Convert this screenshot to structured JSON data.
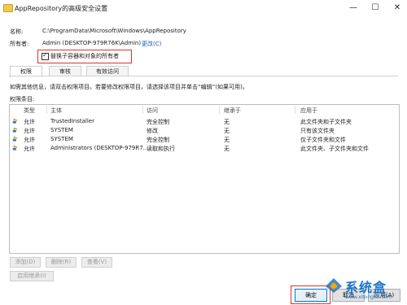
{
  "window": {
    "title": "AppRepository的高级安全设置",
    "minimize": "—",
    "maximize": "☐",
    "close": "✕"
  },
  "info": {
    "name_label": "名称:",
    "name_value": "C:\\ProgramData\\Microsoft\\Windows\\AppRepository",
    "owner_label": "所有者:",
    "owner_value": "Admin (DESKTOP-979R76K\\Admin)",
    "change_link": "更改(C)",
    "replace_owner_checkbox": "替换子容器和对象的所有者",
    "replace_owner_checked": true
  },
  "tabs": [
    {
      "label": "权限",
      "active": true
    },
    {
      "label": "审核",
      "active": false
    },
    {
      "label": "有效访问",
      "active": false
    }
  ],
  "panel": {
    "hint": "如需其他信息，请双击权限项目。若要修改权限项目，请选择该项目并单击“编辑”(如果可用)。",
    "entries_label": "权限条目:"
  },
  "table": {
    "columns": [
      "类型",
      "主体",
      "访问",
      "继承于",
      "应用于"
    ],
    "rows": [
      {
        "type": "允许",
        "principal": "TrustedInstaller",
        "access": "完全控制",
        "inherited": "无",
        "applies": "此文件夹和子文件夹"
      },
      {
        "type": "允许",
        "principal": "SYSTEM",
        "access": "修改",
        "inherited": "无",
        "applies": "只有该文件夹"
      },
      {
        "type": "允许",
        "principal": "SYSTEM",
        "access": "完全控制",
        "inherited": "无",
        "applies": "仅子文件夹和文件"
      },
      {
        "type": "允许",
        "principal": "Administrators (DESKTOP-979R7...",
        "access": "读取和执行",
        "inherited": "无",
        "applies": "此文件夹、子文件夹和文件"
      }
    ]
  },
  "buttons": {
    "add": "添加(D)",
    "remove": "删除(R)",
    "view": "查看(V)",
    "enable_inheritance": "启用继承(I)",
    "ok": "确定",
    "cancel": "取消",
    "apply": "应用(A)"
  },
  "watermark": {
    "brand": "系统盒",
    "url": "www.xitonghe.com"
  },
  "colors": {
    "highlight_box": "#d9352b",
    "link": "#1a5fb4",
    "watermark": "#1e74c8"
  }
}
